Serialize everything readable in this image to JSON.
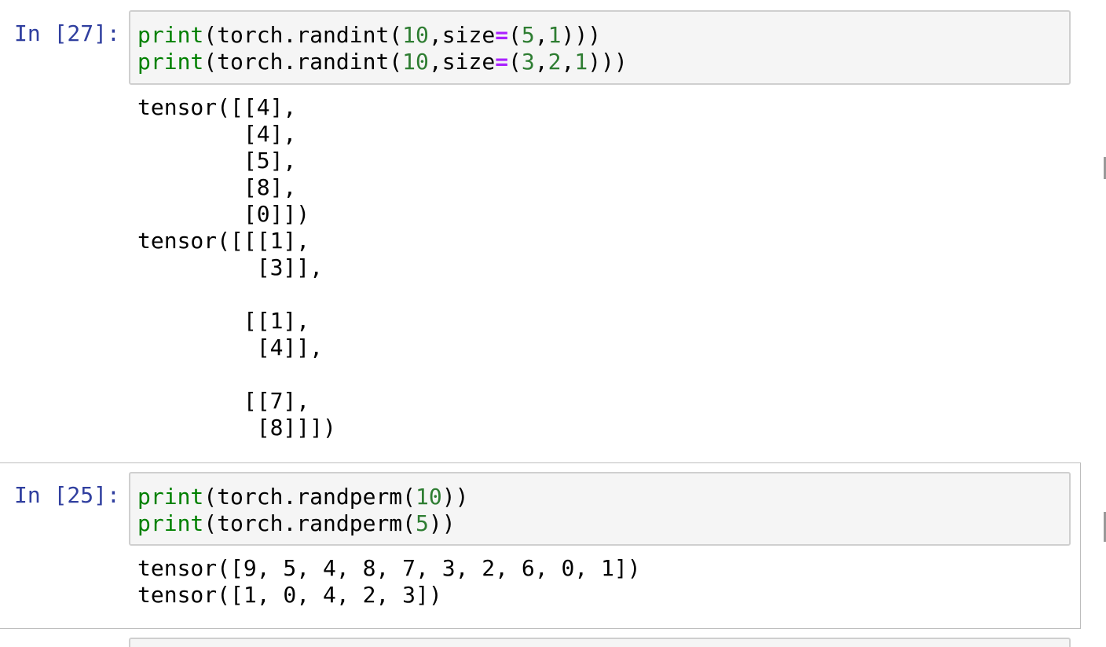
{
  "cells": [
    {
      "prompt": "In [27]:",
      "code": [
        [
          {
            "t": "print",
            "c": "kw"
          },
          {
            "t": "(torch.randint(",
            "c": ""
          },
          {
            "t": "10",
            "c": "num"
          },
          {
            "t": ",size",
            "c": ""
          },
          {
            "t": "=",
            "c": "op"
          },
          {
            "t": "(",
            "c": ""
          },
          {
            "t": "5",
            "c": "num"
          },
          {
            "t": ",",
            "c": ""
          },
          {
            "t": "1",
            "c": "num"
          },
          {
            "t": ")))",
            "c": ""
          }
        ],
        [
          {
            "t": "print",
            "c": "kw"
          },
          {
            "t": "(torch.randint(",
            "c": ""
          },
          {
            "t": "10",
            "c": "num"
          },
          {
            "t": ",size",
            "c": ""
          },
          {
            "t": "=",
            "c": "op"
          },
          {
            "t": "(",
            "c": ""
          },
          {
            "t": "3",
            "c": "num"
          },
          {
            "t": ",",
            "c": ""
          },
          {
            "t": "2",
            "c": "num"
          },
          {
            "t": ",",
            "c": ""
          },
          {
            "t": "1",
            "c": "num"
          },
          {
            "t": ")))",
            "c": ""
          }
        ]
      ],
      "output": [
        "tensor([[4],",
        "        [4],",
        "        [5],",
        "        [8],",
        "        [0]])",
        "tensor([[[1],",
        "         [3]],",
        "",
        "        [[1],",
        "         [4]],",
        "",
        "        [[7],",
        "         [8]]])"
      ]
    },
    {
      "prompt": "In [25]:",
      "code": [
        [
          {
            "t": "print",
            "c": "kw"
          },
          {
            "t": "(torch.randperm(",
            "c": ""
          },
          {
            "t": "10",
            "c": "num"
          },
          {
            "t": "))",
            "c": ""
          }
        ],
        [
          {
            "t": "print",
            "c": "kw"
          },
          {
            "t": "(torch.randperm(",
            "c": ""
          },
          {
            "t": "5",
            "c": "num"
          },
          {
            "t": "))",
            "c": ""
          }
        ]
      ],
      "output": [
        "tensor([9, 5, 4, 8, 7, 3, 2, 6, 0, 1])",
        "tensor([1, 0, 4, 2, 3])"
      ]
    }
  ]
}
